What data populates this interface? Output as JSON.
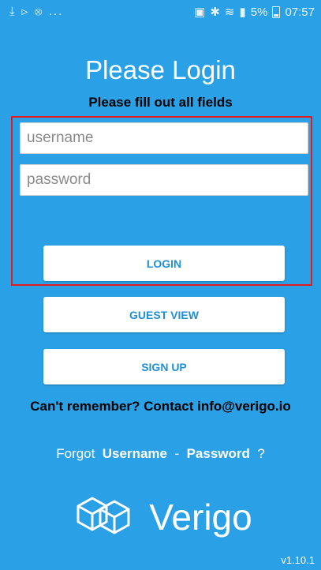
{
  "status_bar": {
    "left_icons": [
      "download-icon",
      "cast-icon",
      "gamepad-icon"
    ],
    "left_more": "...",
    "right_icons": [
      "nfc-icon",
      "bluetooth-icon",
      "wifi-icon",
      "signal-icon"
    ],
    "battery": "5%",
    "time": "07:57"
  },
  "header": {
    "title": "Please Login",
    "subtitle": "Please fill out all fields"
  },
  "form": {
    "username_placeholder": "username",
    "username_value": "",
    "password_placeholder": "password",
    "password_value": ""
  },
  "buttons": {
    "login": "LOGIN",
    "guest": "GUEST VIEW",
    "signup": "SIGN UP"
  },
  "contact_text": "Can't remember? Contact info@verigo.io",
  "forgot": {
    "prefix": "Forgot",
    "username": "Username",
    "separator": "-",
    "password": "Password",
    "suffix": "?"
  },
  "brand": {
    "logo_icon": "verigo-cubes-icon",
    "name": "Verigo"
  },
  "version": "v1.10.1",
  "colors": {
    "background": "#2aa1e6",
    "button_text": "#1f8fd8",
    "highlight": "#e21c1c"
  }
}
